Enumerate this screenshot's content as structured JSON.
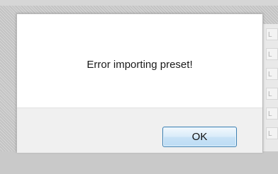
{
  "dialog": {
    "message": "Error importing preset!",
    "ok_label": "OK"
  },
  "background": {
    "row_letters": [
      "L",
      "L",
      "L",
      "L",
      "L",
      "L"
    ]
  }
}
